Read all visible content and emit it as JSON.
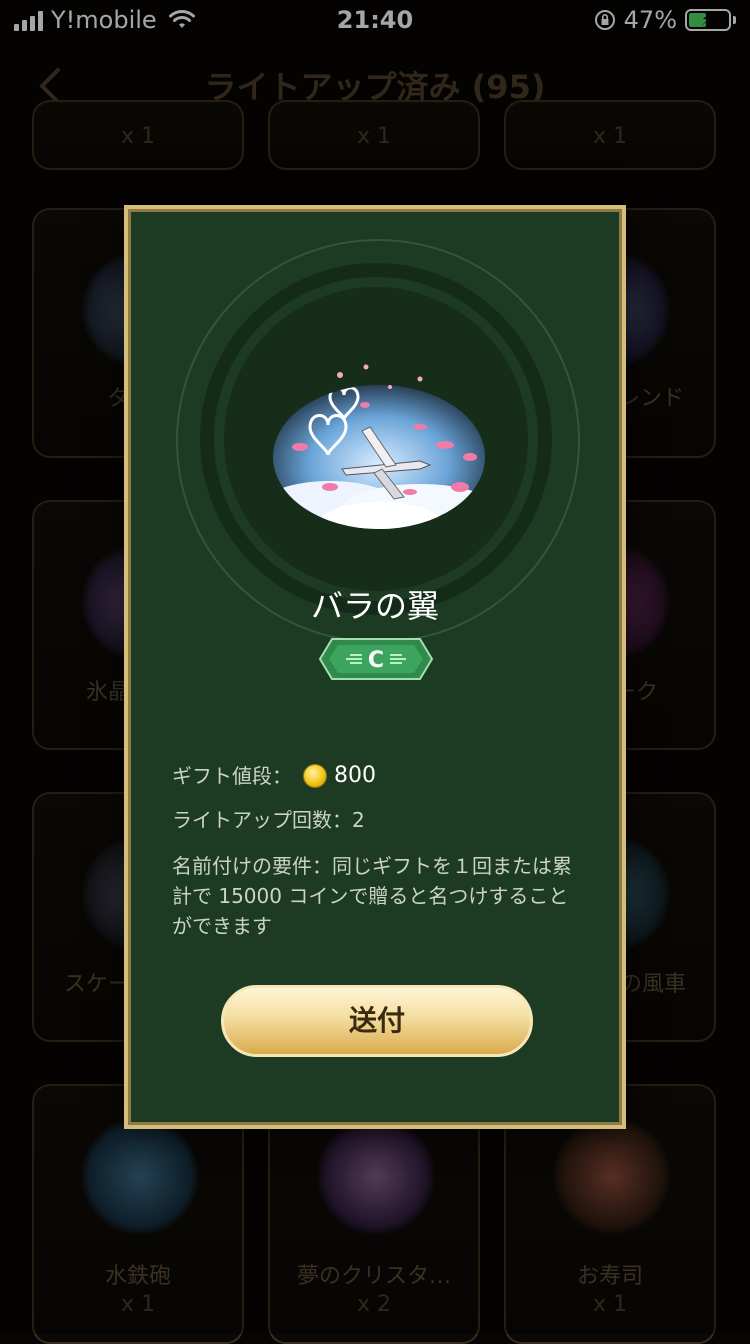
{
  "status_bar": {
    "carrier": "Y!mobile",
    "time": "21:40",
    "battery_percent": "47%",
    "battery_level": 0.47
  },
  "header": {
    "title": "ライトアップ済み (95)"
  },
  "grid": {
    "top_partial_counts": [
      "x 1",
      "x 1",
      "x 1"
    ],
    "row2": [
      {
        "name": "ダ",
        "icon": "diamond-ring-icon"
      },
      {
        "name": "",
        "icon": ""
      },
      {
        "name": "レンド",
        "icon": "winged-card-icon"
      }
    ],
    "row3": [
      {
        "name": "氷晶",
        "icon": "crystal-icon"
      },
      {
        "name": "",
        "icon": ""
      },
      {
        "name": "ワーク",
        "icon": "fireworks-icon"
      }
    ],
    "row4": [
      {
        "name": "スケー",
        "icon": "skate-icon"
      },
      {
        "name": "",
        "icon": ""
      },
      {
        "name": "の風車",
        "icon": "pinwheel-icon"
      }
    ],
    "row5": [
      {
        "name": "水鉄砲",
        "count": "x 1",
        "icon": "water-gun-icon"
      },
      {
        "name": "夢のクリスタ…",
        "count": "x 2",
        "icon": "crystal-pyramid-icon"
      },
      {
        "name": "お寿司",
        "count": "x 1",
        "icon": "sushi-icon"
      }
    ]
  },
  "modal": {
    "gift_name": "バラの翼",
    "rank": "C",
    "price_label": "ギフト値段：",
    "price_value": "800",
    "lightup_count": "ライトアップ回数：2",
    "naming_requirement": "名前付けの要件：同じギフトを１回または累計で 15000 コインで贈ると名つけすることができます",
    "send_button": "送付"
  },
  "colors": {
    "modal_bg": "#1d3a22",
    "modal_border": "#d6be7a",
    "badge_green": "#2f8a4c",
    "button_gold": "#e9c878"
  }
}
